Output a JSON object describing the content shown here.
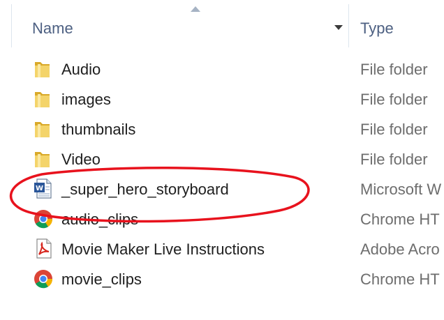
{
  "header": {
    "name_label": "Name",
    "type_label": "Type"
  },
  "files": [
    {
      "name": "Audio",
      "type": "File folder",
      "icon": "folder-icon"
    },
    {
      "name": "images",
      "type": "File folder",
      "icon": "folder-icon"
    },
    {
      "name": "thumbnails",
      "type": "File folder",
      "icon": "folder-icon"
    },
    {
      "name": "Video",
      "type": "File folder",
      "icon": "folder-icon"
    },
    {
      "name": "_super_hero_storyboard",
      "type": "Microsoft W",
      "icon": "word-document-icon"
    },
    {
      "name": "audio_clips",
      "type": "Chrome HT",
      "icon": "chrome-icon"
    },
    {
      "name": "Movie Maker Live Instructions",
      "type": "Adobe Acro",
      "icon": "pdf-icon"
    },
    {
      "name": "movie_clips",
      "type": "Chrome HT",
      "icon": "chrome-icon"
    }
  ],
  "colors": {
    "annotation": "#e8121d",
    "header_text": "#4d6082",
    "type_text": "#6d6d6d"
  }
}
